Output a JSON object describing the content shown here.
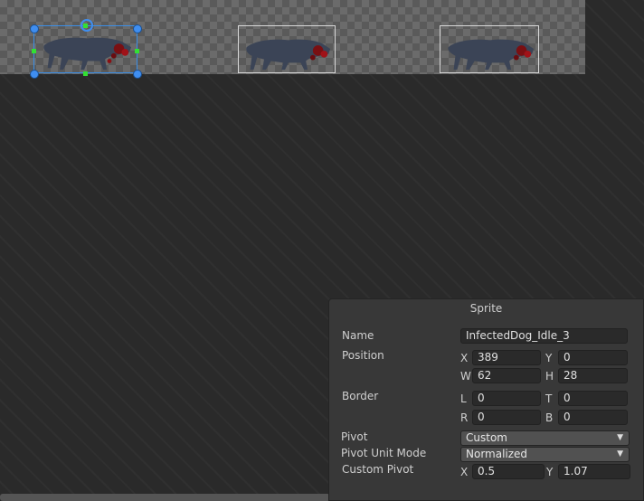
{
  "panel": {
    "title": "Sprite",
    "name": {
      "label": "Name",
      "value": "InfectedDog_Idle_3"
    },
    "position": {
      "label": "Position",
      "x_label": "X",
      "x": "389",
      "y_label": "Y",
      "y": "0",
      "w_label": "W",
      "w": "62",
      "h_label": "H",
      "h": "28"
    },
    "border": {
      "label": "Border",
      "l_label": "L",
      "l": "0",
      "t_label": "T",
      "t": "0",
      "r_label": "R",
      "r": "0",
      "b_label": "B",
      "b": "0"
    },
    "pivot": {
      "label": "Pivot",
      "value": "Custom"
    },
    "pivot_unit_mode": {
      "label": "Pivot Unit Mode",
      "value": "Normalized"
    },
    "custom_pivot": {
      "label": "Custom Pivot",
      "x_label": "X",
      "x": "0.5",
      "y_label": "Y",
      "y": "1.07"
    }
  },
  "canvas": {
    "sprites": [
      {
        "state": "selected"
      },
      {
        "state": "normal"
      },
      {
        "state": "normal"
      }
    ],
    "colors": {
      "selection": "#3a8ee6",
      "handle_mid": "#33e033",
      "frame": "#d8d8d8"
    }
  },
  "icons": {
    "dropdown_arrow": "▼"
  }
}
